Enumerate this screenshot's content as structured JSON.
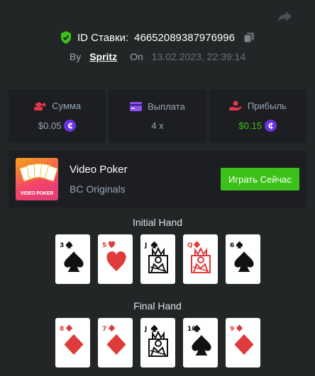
{
  "bet": {
    "id_label": "ID Ставки:",
    "id_value": "46652089387976996",
    "by_label": "By",
    "user": "Spritz",
    "on_label": "On",
    "date": "13.02.2023, 22:39:14"
  },
  "stats": [
    {
      "label": "Сумма",
      "value": "$0.05",
      "coin": true,
      "icon": "money-bag-icon",
      "green": false
    },
    {
      "label": "Выплата",
      "value": "4 x",
      "coin": false,
      "icon": "card-icon",
      "green": false
    },
    {
      "label": "Прибыль",
      "value": "$0.15",
      "coin": true,
      "icon": "profit-hand-icon",
      "green": true
    }
  ],
  "coin_symbol": "₵",
  "game": {
    "title": "Video Poker",
    "subtitle": "BC Originals",
    "thumb_label": "VIDEO POKER",
    "play_label": "Играть Сейчас"
  },
  "hands": {
    "initial_title": "Initial Hand",
    "final_title": "Final Hand",
    "initial": [
      {
        "rank": "3",
        "suit": "spade"
      },
      {
        "rank": "5",
        "suit": "heart"
      },
      {
        "rank": "J",
        "suit": "spade",
        "face": true
      },
      {
        "rank": "Q",
        "suit": "diamond",
        "face": true
      },
      {
        "rank": "6",
        "suit": "spade"
      }
    ],
    "final": [
      {
        "rank": "8",
        "suit": "diamond"
      },
      {
        "rank": "7",
        "suit": "diamond"
      },
      {
        "rank": "J",
        "suit": "spade",
        "face": true
      },
      {
        "rank": "10",
        "suit": "spade"
      },
      {
        "rank": "9",
        "suit": "diamond"
      }
    ]
  },
  "colors": {
    "background": "#232626",
    "panel": "#1c1e22",
    "accent_green": "#3bc117",
    "coin_purple": "#6b33e6",
    "muted_text": "#98a7b5"
  }
}
